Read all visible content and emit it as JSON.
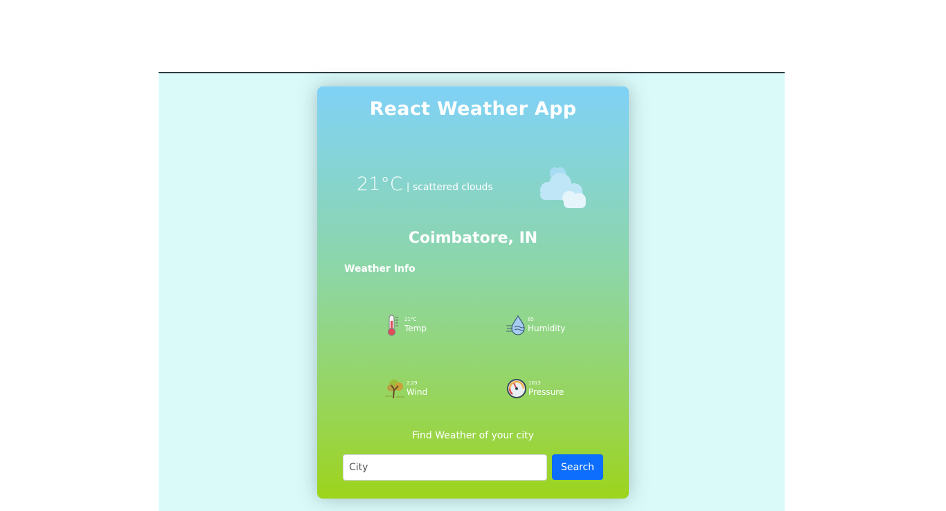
{
  "app": {
    "title": "React Weather App"
  },
  "current": {
    "temperature": "21°C",
    "description": "| scattered clouds",
    "icon": "scattered-clouds-icon",
    "city": "Coimbatore, IN"
  },
  "info": {
    "heading": "Weather Info",
    "stats": [
      {
        "value": "21°C",
        "label": "Temp",
        "icon": "thermometer-icon"
      },
      {
        "value": "65",
        "label": "Humidity",
        "icon": "humidity-icon"
      },
      {
        "value": "2.29",
        "label": "Wind",
        "icon": "wind-tree-icon"
      },
      {
        "value": "1013",
        "label": "Pressure",
        "icon": "pressure-gauge-icon"
      }
    ]
  },
  "search": {
    "heading": "Find Weather of your city",
    "placeholder": "City",
    "button_label": "Search"
  },
  "colors": {
    "page_background": "#dafafa",
    "card_top": "#80d2f7",
    "card_bottom": "#9dd41c",
    "button": "#0d6efd",
    "text": "#ffffff"
  }
}
